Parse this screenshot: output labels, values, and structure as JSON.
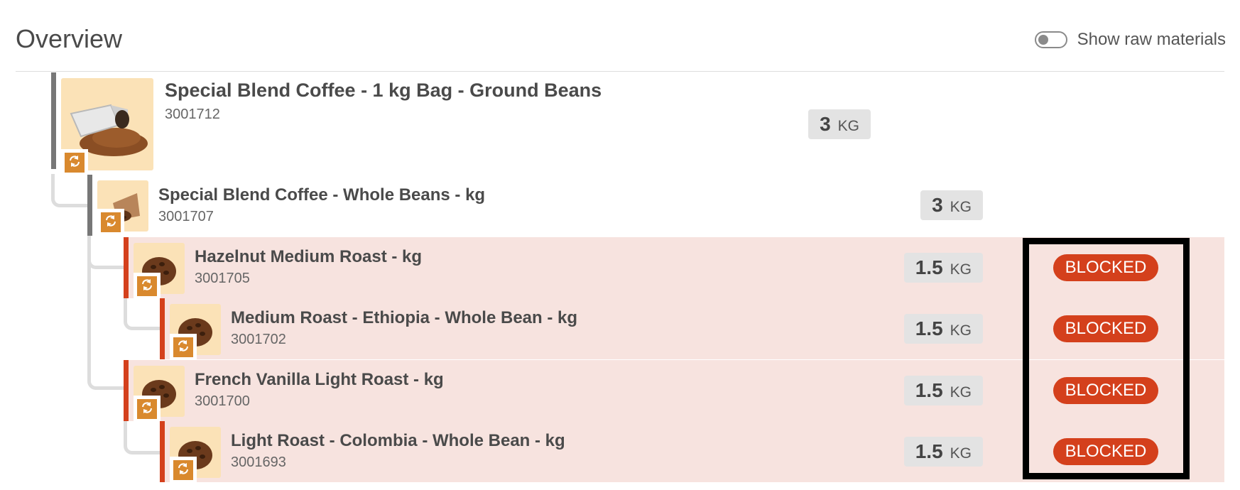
{
  "header": {
    "title": "Overview",
    "toggle_label": "Show raw materials",
    "toggle_on": false
  },
  "items": [
    {
      "name": "Special Blend Coffee - 1 kg Bag - Ground Beans",
      "code": "3001712",
      "qty": "3",
      "unit": "KG",
      "status": "",
      "thumb": "coffee-bag-image",
      "level": 0
    },
    {
      "name": "Special Blend Coffee - Whole Beans - kg",
      "code": "3001707",
      "qty": "3",
      "unit": "KG",
      "status": "",
      "thumb": "coffee-beans-sack-image",
      "level": 1
    },
    {
      "name": "Hazelnut Medium Roast - kg",
      "code": "3001705",
      "qty": "1.5",
      "unit": "KG",
      "status": "BLOCKED",
      "thumb": "coffee-beans-pile-image",
      "level": 2
    },
    {
      "name": "Medium Roast - Ethiopia - Whole Bean - kg",
      "code": "3001702",
      "qty": "1.5",
      "unit": "KG",
      "status": "BLOCKED",
      "thumb": "coffee-beans-pile-image",
      "level": 3
    },
    {
      "name": "French Vanilla Light Roast - kg",
      "code": "3001700",
      "qty": "1.5",
      "unit": "KG",
      "status": "BLOCKED",
      "thumb": "coffee-beans-pile-image",
      "level": 2
    },
    {
      "name": "Light Roast - Colombia - Whole Bean - kg",
      "code": "3001693",
      "qty": "1.5",
      "unit": "KG",
      "status": "BLOCKED",
      "thumb": "coffee-beans-pile-image",
      "level": 3
    }
  ],
  "colors": {
    "blocked_bg": "#f7e3df",
    "blocked_accent": "#d4401c",
    "normal_accent": "#777777",
    "badge": "#d4401c",
    "thumb_bg": "#fbe2b7",
    "swap_icon": "#d9892e"
  },
  "icons": {
    "swap": "refresh-swap-icon"
  }
}
